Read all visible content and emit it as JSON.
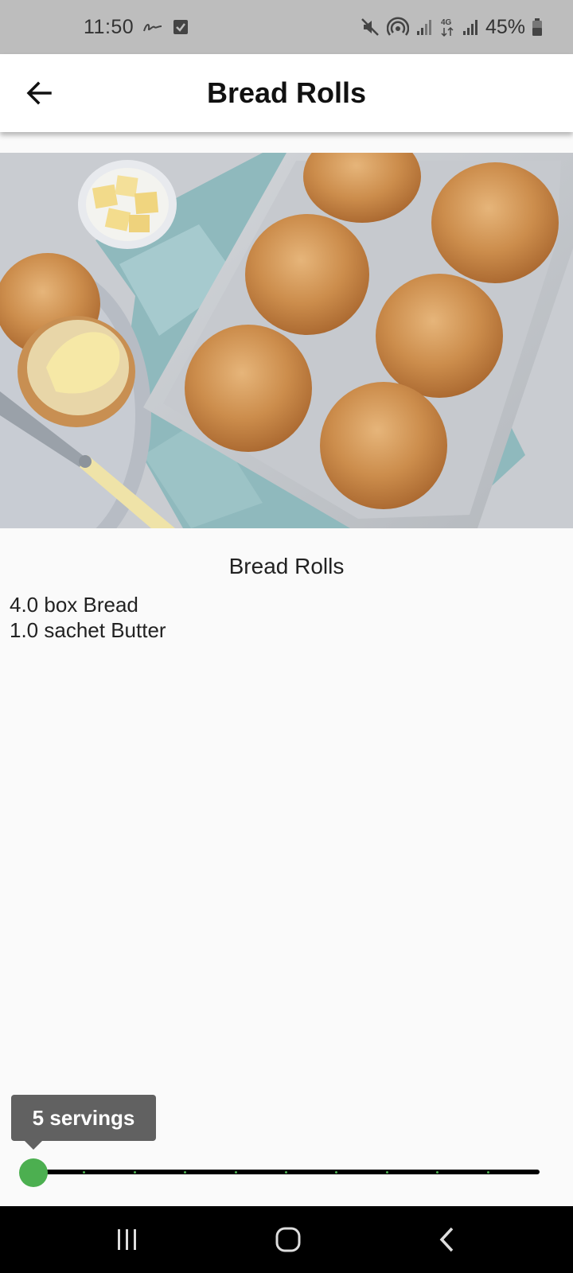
{
  "status_bar": {
    "time": "11:50",
    "battery": "45%",
    "icons": [
      "signature-icon",
      "checkbox-icon",
      "mute-icon",
      "hotspot-icon",
      "signal-icon",
      "4g-data-icon",
      "signal-icon",
      "battery-icon"
    ]
  },
  "app_bar": {
    "title": "Bread Rolls",
    "back_icon": "back-arrow-icon"
  },
  "hero_image": {
    "subject": "bread rolls on baking tray with butter"
  },
  "recipe": {
    "title": "Bread Rolls",
    "ingredients": [
      "4.0 box Bread",
      "1.0 sachet Butter"
    ]
  },
  "servings_slider": {
    "tooltip": "5 servings",
    "value_fraction": 0.0,
    "tick_count": 10,
    "accent_color": "#4caf50",
    "track_color": "#000000"
  },
  "nav_bar": {
    "icons": [
      "recents-icon",
      "home-icon",
      "back-icon"
    ]
  }
}
